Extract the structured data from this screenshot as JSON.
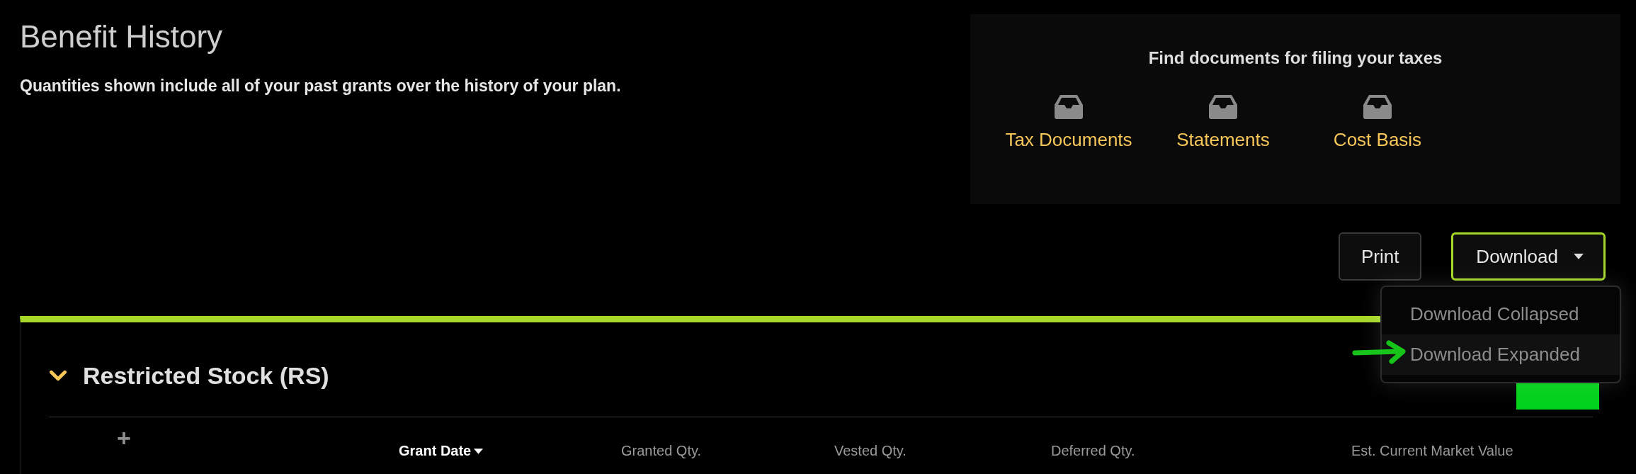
{
  "page": {
    "title": "Benefit History",
    "subtitle": "Quantities shown include all of your past grants over the history of your plan."
  },
  "tax_panel": {
    "heading": "Find documents for filing your taxes",
    "links": [
      {
        "label": "Tax Documents"
      },
      {
        "label": "Statements"
      },
      {
        "label": "Cost Basis"
      }
    ]
  },
  "actions": {
    "print": "Print",
    "download": {
      "label": "Download",
      "expanded": true,
      "menu": [
        {
          "label": "Download Collapsed",
          "selected": false
        },
        {
          "label": "Download Expanded",
          "selected": true
        }
      ]
    }
  },
  "section": {
    "title": "Restricted Stock (RS)",
    "expanded": true,
    "add": "+",
    "columns": [
      {
        "label": "Grant Date",
        "sorted": true
      },
      {
        "label": "Granted Qty.",
        "sorted": false
      },
      {
        "label": "Vested Qty.",
        "sorted": false
      },
      {
        "label": "Deferred Qty.",
        "sorted": false
      },
      {
        "label": "Est. Current Market Value",
        "sorted": false
      }
    ]
  }
}
